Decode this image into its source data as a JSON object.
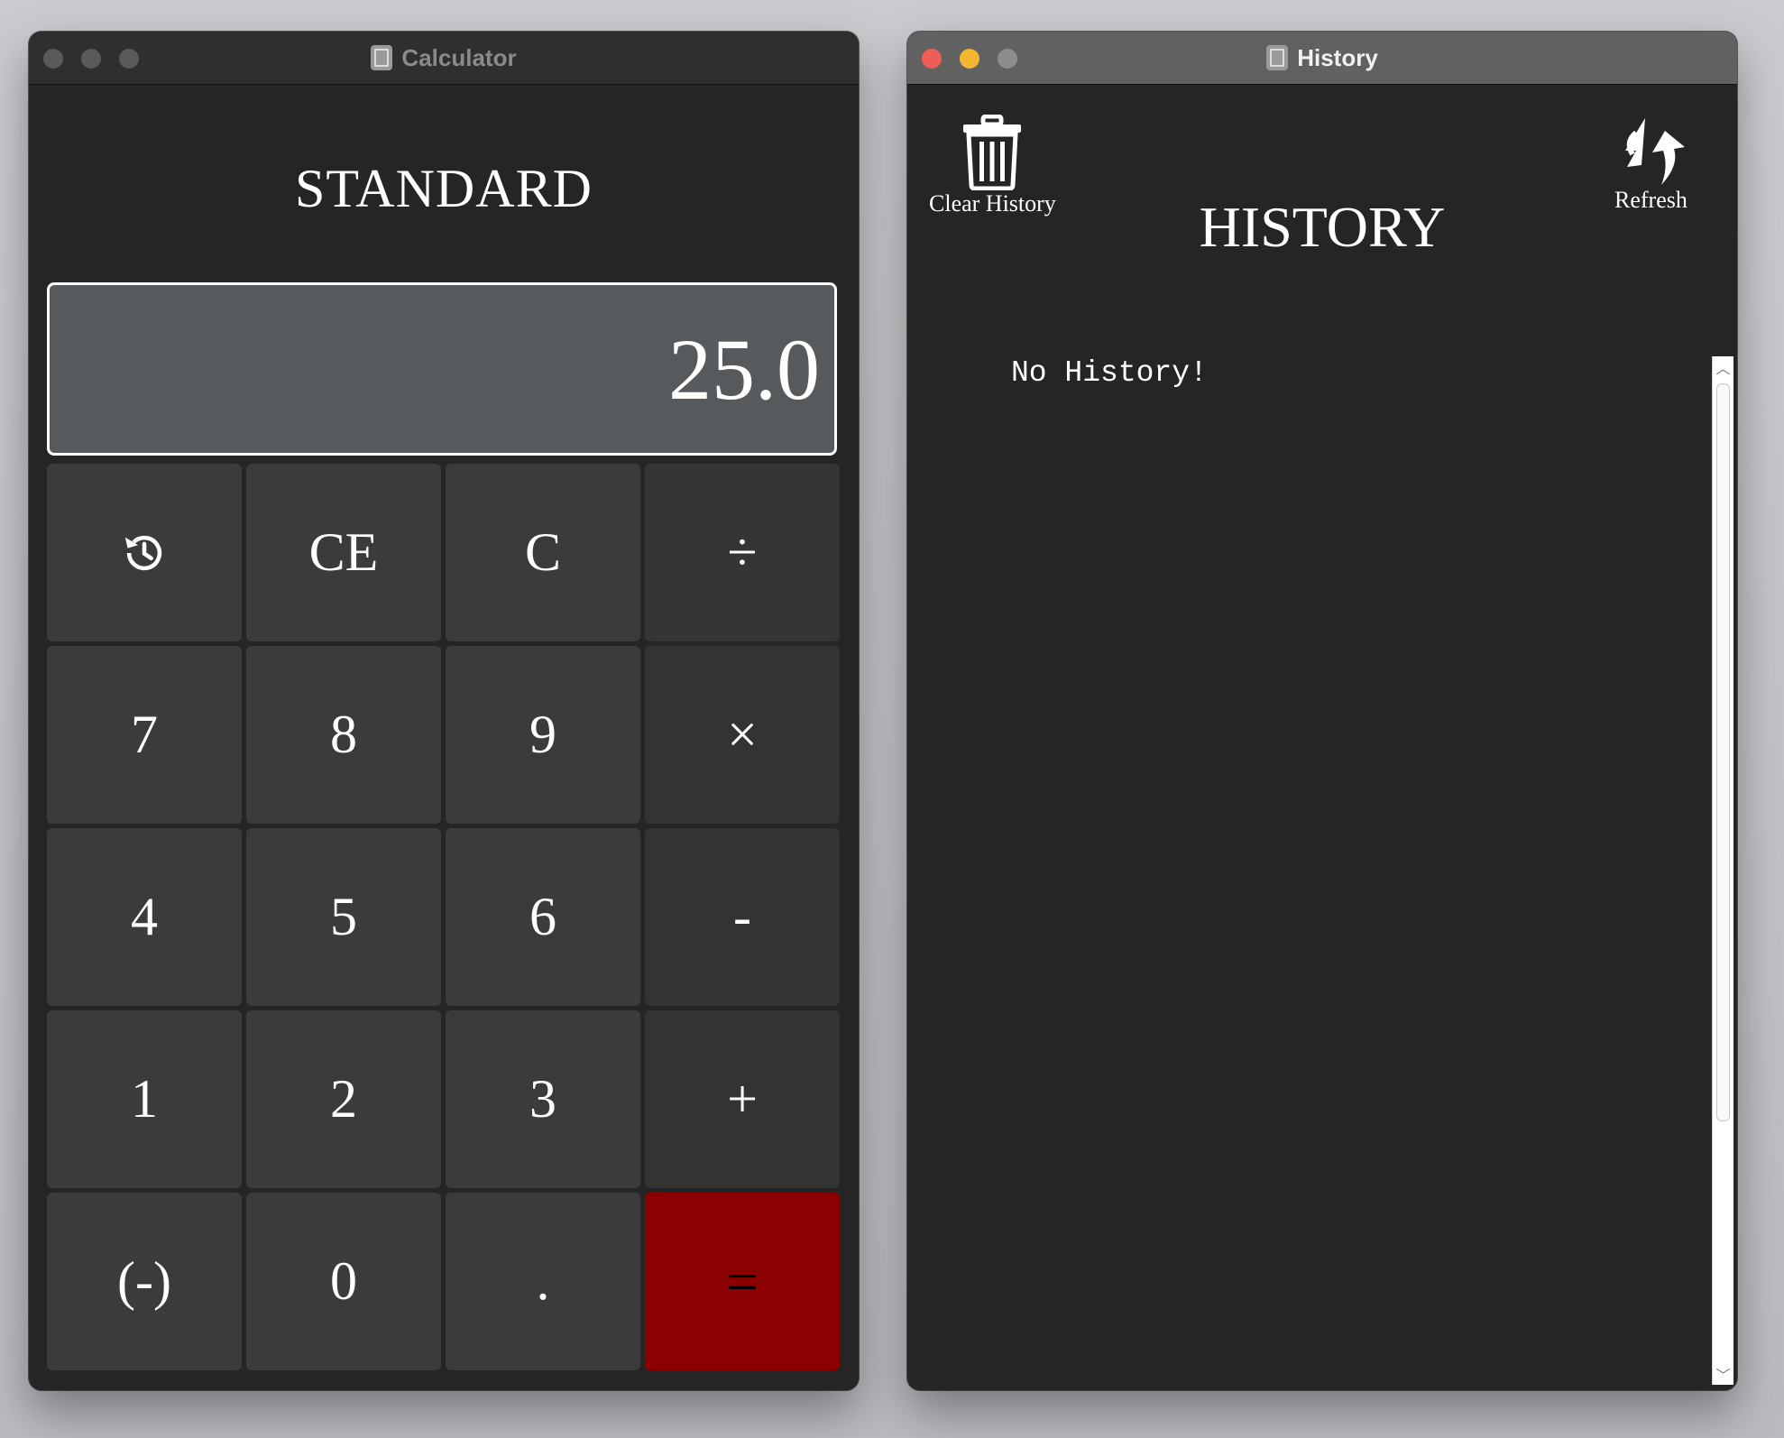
{
  "calculator_window": {
    "title": "Calculator",
    "heading": "STANDARD",
    "display_value": "25.0",
    "keys": [
      {
        "label": "",
        "icon": "history-icon"
      },
      {
        "label": "CE"
      },
      {
        "label": "C"
      },
      {
        "label": "÷"
      },
      {
        "label": "7"
      },
      {
        "label": "8"
      },
      {
        "label": "9"
      },
      {
        "label": "×"
      },
      {
        "label": "4"
      },
      {
        "label": "5"
      },
      {
        "label": "6"
      },
      {
        "label": "-"
      },
      {
        "label": "1"
      },
      {
        "label": "2"
      },
      {
        "label": "3"
      },
      {
        "label": "+"
      },
      {
        "label": "(-)"
      },
      {
        "label": "0"
      },
      {
        "label": "."
      },
      {
        "label": "="
      }
    ]
  },
  "history_window": {
    "title": "History",
    "heading": "HISTORY",
    "clear_label": "Clear History",
    "clear_icon": "trash-icon",
    "refresh_label": "Refresh",
    "refresh_icon": "refresh-icon",
    "empty_message": "No History!"
  },
  "colors": {
    "background": "#252525",
    "display_bg": "#565a5d",
    "key_bg": "#3b3b3b",
    "equals_bg": "#8b0000"
  }
}
